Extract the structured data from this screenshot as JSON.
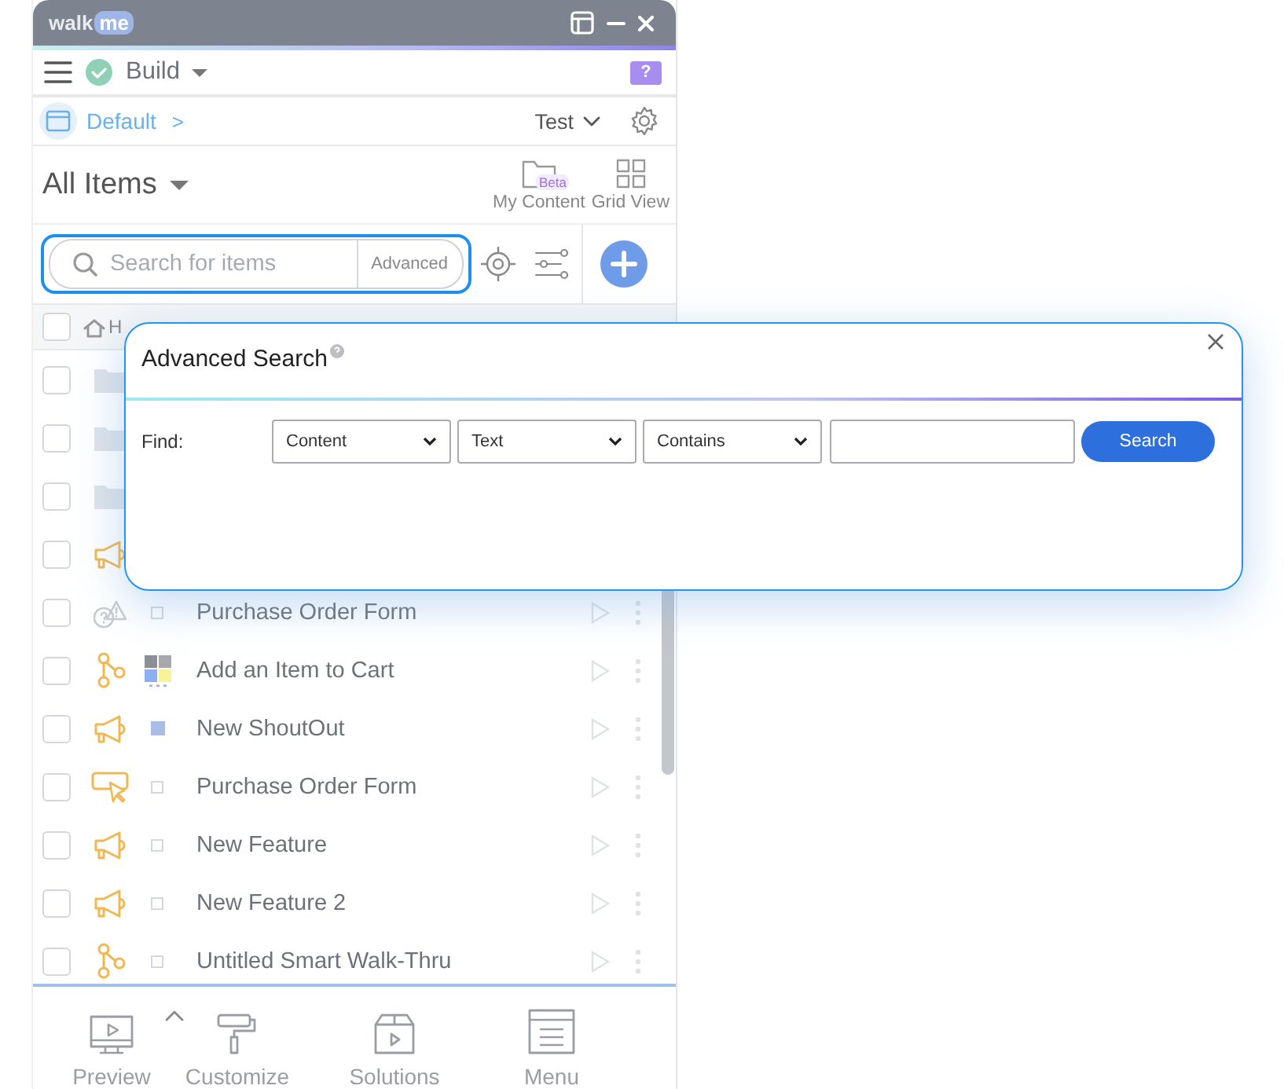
{
  "window": {
    "logo_left": "walk",
    "logo_right": "me"
  },
  "toolbar": {
    "mode": "Build",
    "help": "?"
  },
  "breadcrumb": {
    "environment": "Default",
    "separator": ">",
    "target": "Test"
  },
  "header": {
    "title": "All Items",
    "views": [
      {
        "label": "My Content",
        "badge": "Beta"
      },
      {
        "label": "Grid View"
      }
    ]
  },
  "search": {
    "placeholder": "Search for items",
    "advanced": "Advanced"
  },
  "list_header": {
    "checked": false,
    "crumb": "H"
  },
  "items": [
    {
      "kind": "folder",
      "checked": false
    },
    {
      "kind": "folder",
      "checked": false
    },
    {
      "kind": "folder",
      "checked": false
    },
    {
      "kind": "shoutout",
      "checked": false
    },
    {
      "kind": "survey",
      "checked": false,
      "status": {
        "kind": "outline"
      },
      "name": "Purchase Order Form"
    },
    {
      "kind": "walkthru",
      "checked": false,
      "status": {
        "kind": "tiles"
      },
      "name": "Add an Item to Cart"
    },
    {
      "kind": "shoutout",
      "checked": false,
      "status": {
        "kind": "filled"
      },
      "name": "New ShoutOut"
    },
    {
      "kind": "launcher",
      "checked": false,
      "status": {
        "kind": "outline"
      },
      "name": "Purchase Order Form"
    },
    {
      "kind": "shoutout",
      "checked": false,
      "status": {
        "kind": "outline"
      },
      "name": "New Feature"
    },
    {
      "kind": "shoutout",
      "checked": false,
      "status": {
        "kind": "outline"
      },
      "name": "New Feature 2"
    },
    {
      "kind": "walkthru",
      "checked": false,
      "status": {
        "kind": "outline"
      },
      "name": "Untitled Smart Walk-Thru"
    }
  ],
  "nav": [
    {
      "kind": "preview",
      "label": "Preview"
    },
    {
      "kind": "customize",
      "label": "Customize"
    },
    {
      "kind": "solutions",
      "label": "Solutions"
    },
    {
      "kind": "menu",
      "label": "Menu"
    }
  ],
  "dialog": {
    "title": "Advanced Search",
    "find_label": "Find:",
    "selects": [
      "Content",
      "Text",
      "Contains"
    ],
    "button": "Search"
  }
}
